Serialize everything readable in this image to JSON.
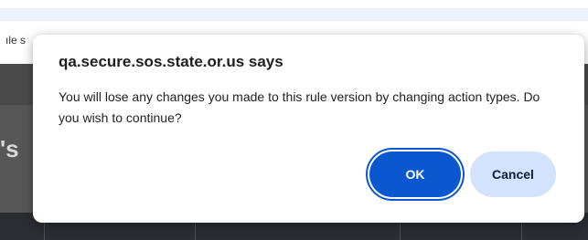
{
  "background": {
    "snippet_text": "ıle s",
    "heading_fragment": "'s"
  },
  "dialog": {
    "title": "qa.secure.sos.state.or.us says",
    "message": "You will lose any changes you made to this rule version by changing action types. Do you wish to continue?",
    "ok_label": "OK",
    "cancel_label": "Cancel"
  },
  "colors": {
    "primary": "#0b57d0",
    "secondary_button": "#d3e3fd",
    "overlay": "#4a4a4a"
  }
}
